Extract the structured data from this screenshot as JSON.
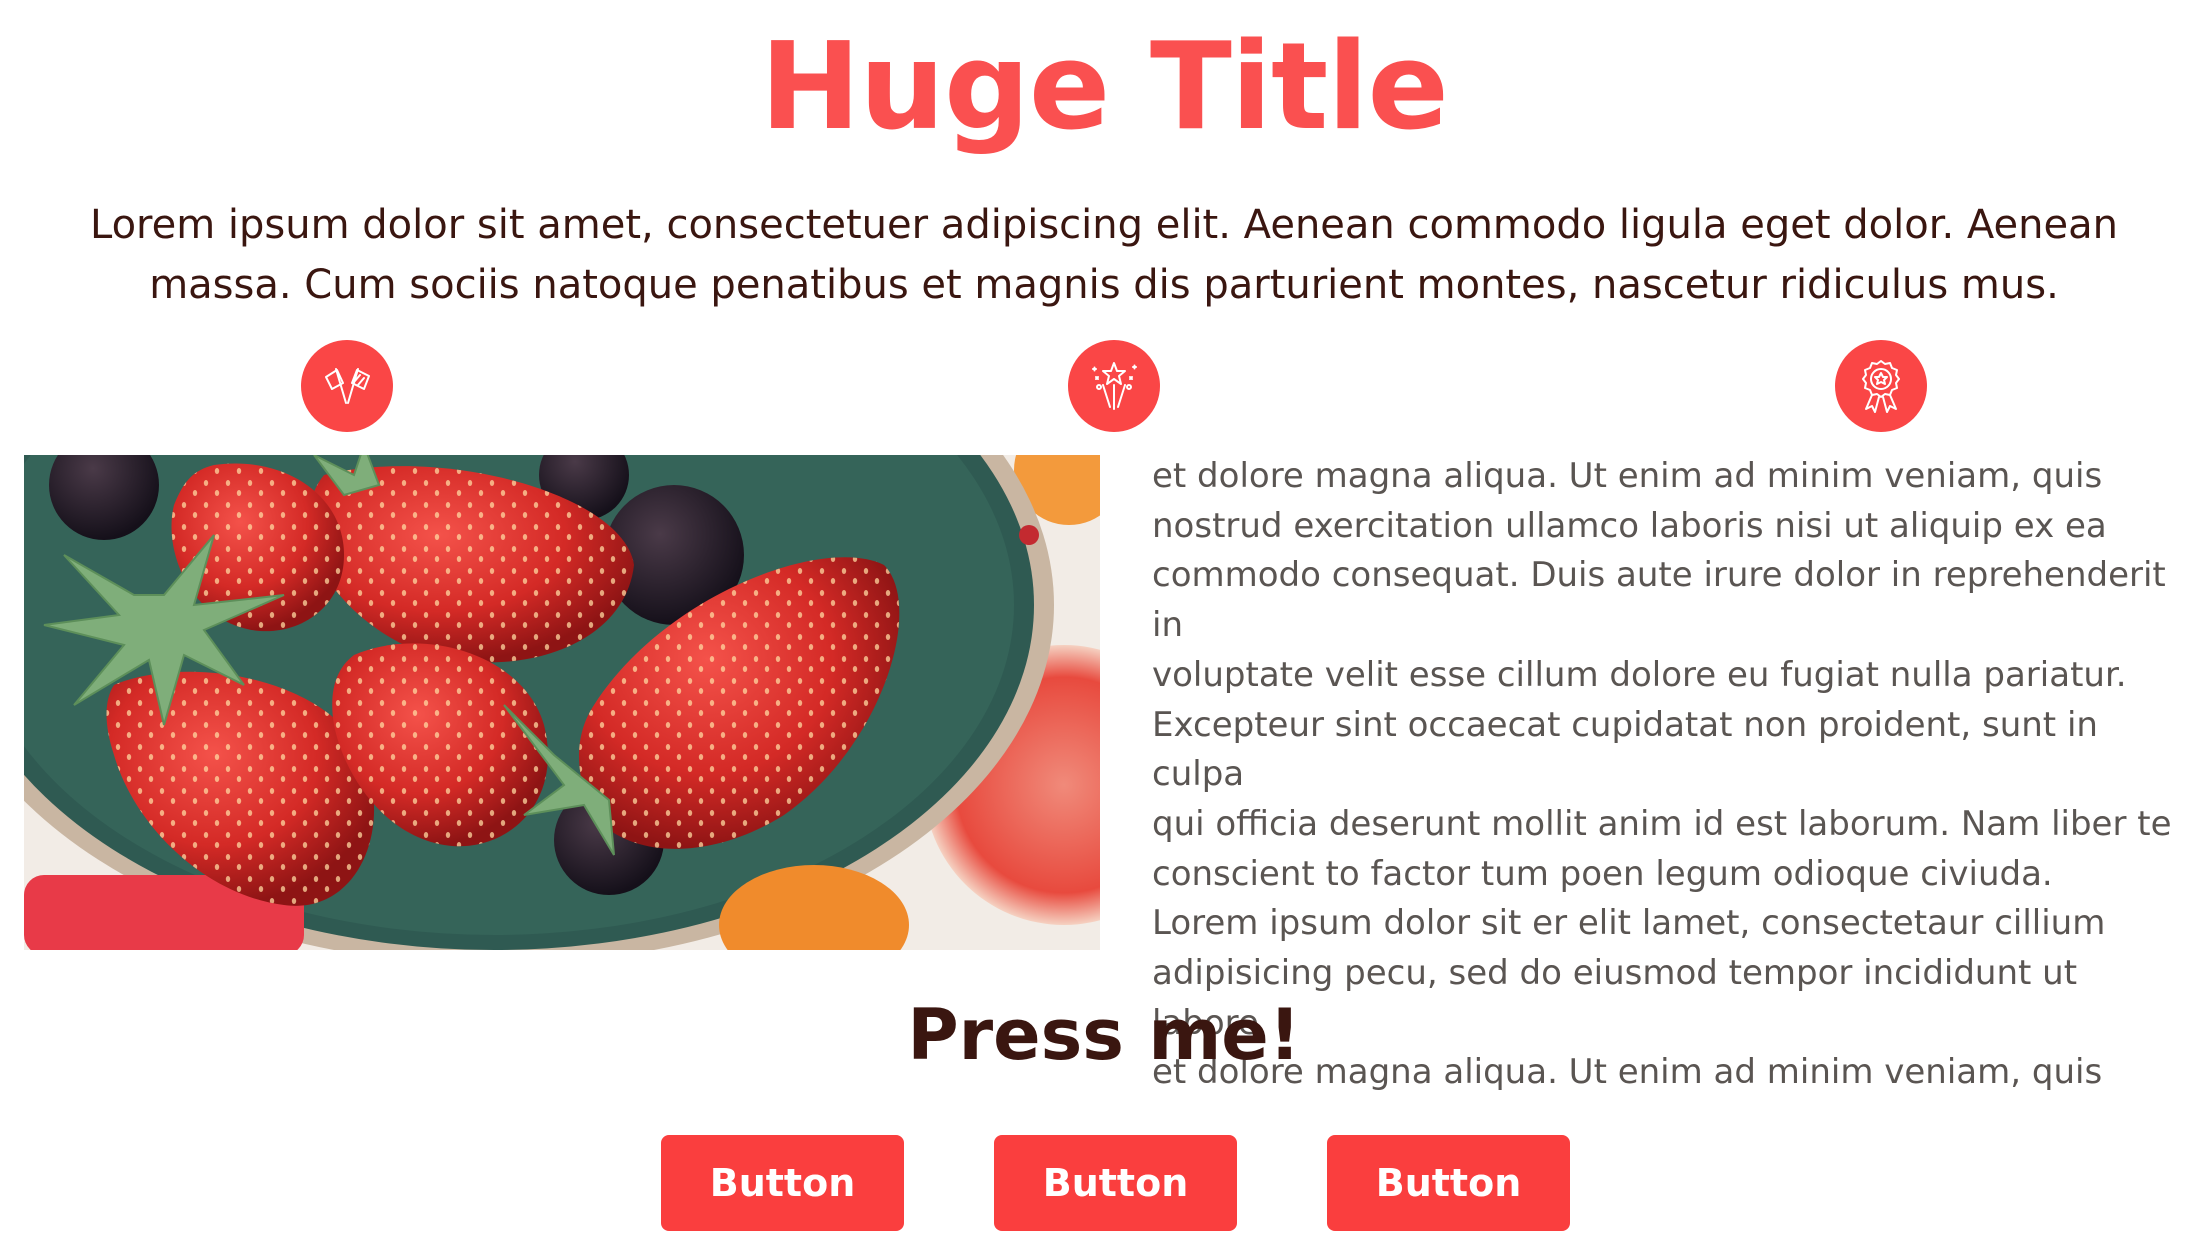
{
  "header": {
    "title": "Huge Title",
    "intro": "Lorem ipsum dolor sit amet, consectetuer adipiscing elit. Aenean commodo ligula eget dolor. Aenean massa. Cum sociis natoque penatibus et magnis dis parturient montes, nascetur ridiculus mus."
  },
  "features": {
    "icons": [
      "flags-icon",
      "fireworks-icon",
      "award-ribbon-icon"
    ]
  },
  "content": {
    "image": "strawberries-bowl-photo",
    "text": "et dolore magna aliqua. Ut enim ad minim veniam, quis\nnostrud exercitation ullamco laboris nisi ut aliquip ex ea\ncommodo consequat. Duis aute irure dolor in reprehenderit in\nvoluptate velit esse cillum dolore eu fugiat nulla pariatur.\nExcepteur sint occaecat cupidatat non proident, sunt in culpa\nqui officia deserunt mollit anim id est laborum. Nam liber te\nconscient to factor tum poen legum odioque civiuda.\nLorem ipsum dolor sit er elit lamet, consectetaur cillium\nadipisicing pecu, sed do eiusmod tempor incididunt ut labore\net dolore magna aliqua. Ut enim ad minim veniam, quis"
  },
  "cta": {
    "heading": "Press me!",
    "buttons": [
      {
        "label": "Button"
      },
      {
        "label": "Button"
      },
      {
        "label": "Button"
      }
    ]
  },
  "colors": {
    "accent": "#fa5050",
    "button": "#fa3e3e",
    "heading_dark": "#3a1610",
    "body_text": "#5a5552",
    "background": "#ffffff"
  }
}
